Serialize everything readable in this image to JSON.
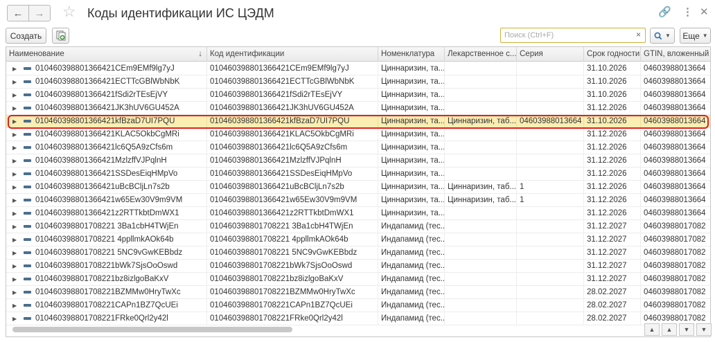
{
  "window": {
    "title": "Коды идентификации ИС ЦЭДМ",
    "back_icon": "arrow-left-icon",
    "forward_icon": "arrow-right-icon",
    "favorite_icon": "star-icon",
    "link_icon": "link-icon",
    "menu_icon": "more-vertical-icon",
    "close_icon": "close-icon"
  },
  "toolbar": {
    "create_label": "Создать",
    "search_placeholder": "Поиск (Ctrl+F)",
    "search_value": "",
    "more_label": "Еще",
    "accent_color": "#d2b035"
  },
  "table": {
    "columns": [
      "Наименование",
      "Код идентификации",
      "Номенклатура",
      "Лекарственное с...",
      "Серия",
      "Срок годности",
      "GTIN, вложенный"
    ],
    "sorted_column": "Наименование",
    "selected_row_index": 4,
    "selected_row_color": "#fbeeb3",
    "highlight_color": "#e02020",
    "rows": [
      [
        "010460398801366421CEm9EMf9lg7yJ",
        "010460398801366421CEm9EMf9lg7yJ",
        "Циннаризин, та...",
        "",
        "",
        "31.10.2026",
        "04603988013664"
      ],
      [
        "010460398801366421ECTTcGBlWbNbK",
        "010460398801366421ECTTcGBlWbNbK",
        "Циннаризин, та...",
        "",
        "",
        "31.10.2026",
        "04603988013664"
      ],
      [
        "010460398801366421fSdi2rTEsEjVY",
        "010460398801366421fSdi2rTEsEjVY",
        "Циннаризин, та...",
        "",
        "",
        "31.10.2026",
        "04603988013664"
      ],
      [
        "010460398801366421JK3hUV6GU452A",
        "010460398801366421JK3hUV6GU452A",
        "Циннаризин, та...",
        "",
        "",
        "31.12.2026",
        "04603988013664"
      ],
      [
        "010460398801366421kfBzaD7UI7PQU",
        "010460398801366421kfBzaD7UI7PQU",
        "Циннаризин, та...",
        "Циннаризин, таб...",
        "04603988013664",
        "31.10.2026",
        "04603988013664"
      ],
      [
        "010460398801366421KLAC5OkbCgMRi",
        "010460398801366421KLAC5OkbCgMRi",
        "Циннаризин, та...",
        "",
        "",
        "31.12.2026",
        "04603988013664"
      ],
      [
        "010460398801366421lc6Q5A9zCfs6m",
        "010460398801366421lc6Q5A9zCfs6m",
        "Циннаризин, та...",
        "",
        "",
        "31.12.2026",
        "04603988013664"
      ],
      [
        "010460398801366421MzlzffVJPqlnH",
        "010460398801366421MzlzffVJPqlnH",
        "Циннаризин, та...",
        "",
        "",
        "31.12.2026",
        "04603988013664"
      ],
      [
        "010460398801366421SSDesEiqHMpVo",
        "010460398801366421SSDesEiqHMpVo",
        "Циннаризин, та...",
        "",
        "",
        "31.12.2026",
        "04603988013664"
      ],
      [
        "010460398801366421uBcBCljLn7s2b",
        "010460398801366421uBcBCljLn7s2b",
        "Циннаризин, та...",
        "Циннаризин, таб...",
        "1",
        "31.12.2026",
        "04603988013664"
      ],
      [
        "010460398801366421w65Ew30V9m9VM",
        "010460398801366421w65Ew30V9m9VM",
        "Циннаризин, та...",
        "Циннаризин, таб...",
        "1",
        "31.12.2026",
        "04603988013664"
      ],
      [
        "010460398801366421z2RTTkbtDmWX1",
        "010460398801366421z2RTTkbtDmWX1",
        "Циннаризин, та...",
        "",
        "",
        "31.12.2026",
        "04603988013664"
      ],
      [
        "010460398801708221 3Ba1cbH4TWjEn",
        "010460398801708221 3Ba1cbH4TWjEn",
        "Индапамид (тес...",
        "",
        "",
        "31.12.2027",
        "04603988017082"
      ],
      [
        "010460398801708221 4ppllmkAOk64b",
        "010460398801708221 4ppllmkAOk64b",
        "Индапамид (тес...",
        "",
        "",
        "31.12.2027",
        "04603988017082"
      ],
      [
        "010460398801708221 5NC9vGwKEBbdz",
        "010460398801708221 5NC9vGwKEBbdz",
        "Индапамид (тес...",
        "",
        "",
        "31.12.2027",
        "04603988017082"
      ],
      [
        "010460398801708221bWk7SjsOoOswd",
        "010460398801708221bWk7SjsOoOswd",
        "Индапамид (тес...",
        "",
        "",
        "31.12.2027",
        "04603988017082"
      ],
      [
        "010460398801708221bz8izlgoBaKxV",
        "010460398801708221bz8izlgoBaKxV",
        "Индапамид (тес...",
        "",
        "",
        "31.12.2027",
        "04603988017082"
      ],
      [
        "010460398801708221BZMMw0HryTwXc",
        "010460398801708221BZMMw0HryTwXc",
        "Индапамид (тес...",
        "",
        "",
        "28.02.2027",
        "04603988017082"
      ],
      [
        "010460398801708221CAPn1BZ7QcUEi",
        "010460398801708221CAPn1BZ7QcUEi",
        "Индапамид (тес...",
        "",
        "",
        "28.02.2027",
        "04603988017082"
      ],
      [
        "010460398801708221FRke0Qrl2y42l",
        "010460398801708221FRke0Qrl2y42l",
        "Индапамид (тес...",
        "",
        "",
        "28.02.2027",
        "04603988017082"
      ]
    ]
  }
}
